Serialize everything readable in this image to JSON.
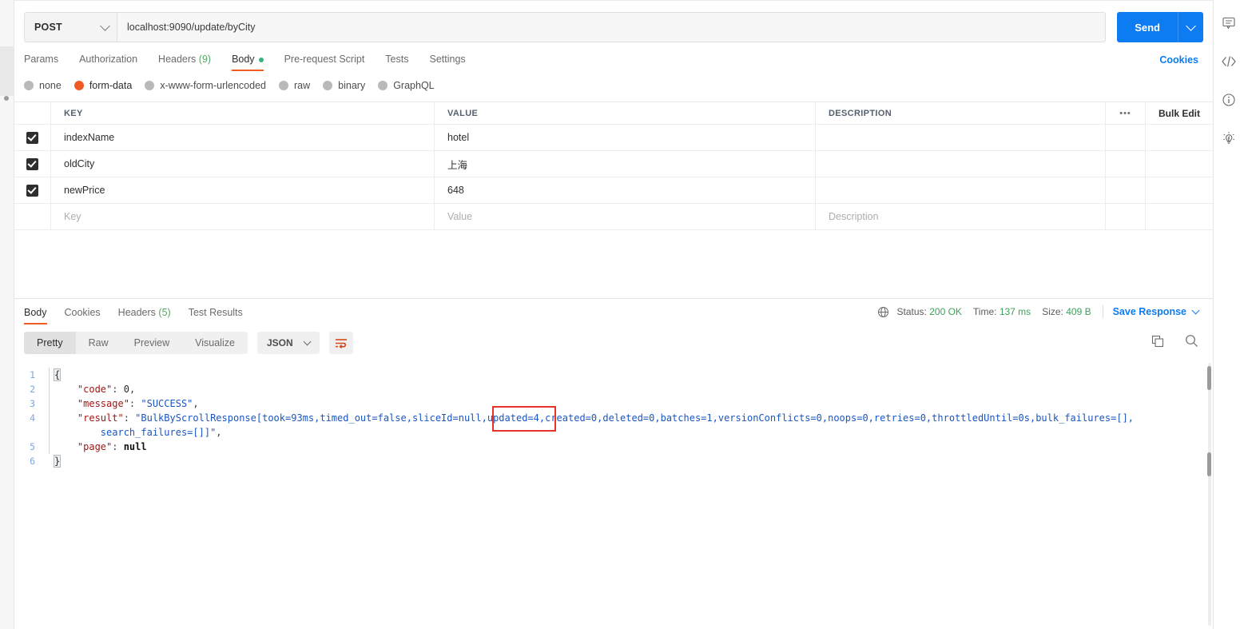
{
  "request": {
    "method": "POST",
    "url": "localhost:9090/update/byCity",
    "send_label": "Send",
    "tabs": [
      {
        "label": "Params",
        "active": false
      },
      {
        "label": "Authorization",
        "active": false
      },
      {
        "label": "Headers",
        "count": "(9)",
        "active": false
      },
      {
        "label": "Body",
        "active": true,
        "dot": true
      },
      {
        "label": "Pre-request Script",
        "active": false
      },
      {
        "label": "Tests",
        "active": false
      },
      {
        "label": "Settings",
        "active": false
      }
    ],
    "cookies_label": "Cookies",
    "body_types": [
      {
        "label": "none",
        "selected": false
      },
      {
        "label": "form-data",
        "selected": true
      },
      {
        "label": "x-www-form-urlencoded",
        "selected": false
      },
      {
        "label": "raw",
        "selected": false
      },
      {
        "label": "binary",
        "selected": false
      },
      {
        "label": "GraphQL",
        "selected": false
      }
    ]
  },
  "params_table": {
    "headers": {
      "key": "KEY",
      "value": "VALUE",
      "description": "DESCRIPTION"
    },
    "bulk_edit_label": "Bulk Edit",
    "more_label": "•••",
    "rows": [
      {
        "checked": true,
        "key": "indexName",
        "value": "hotel",
        "description": ""
      },
      {
        "checked": true,
        "key": "oldCity",
        "value": "上海",
        "description": ""
      },
      {
        "checked": true,
        "key": "newPrice",
        "value": "648",
        "description": ""
      }
    ],
    "placeholder_row": {
      "key": "Key",
      "value": "Value",
      "description": "Description"
    }
  },
  "response": {
    "tabs": [
      {
        "label": "Body",
        "active": true
      },
      {
        "label": "Cookies",
        "active": false
      },
      {
        "label": "Headers",
        "count": "(5)",
        "active": false
      },
      {
        "label": "Test Results",
        "active": false
      }
    ],
    "status_prefix": "Status:",
    "status_value": "200 OK",
    "time_prefix": "Time:",
    "time_value": "137 ms",
    "size_prefix": "Size:",
    "size_value": "409 B",
    "save_response_label": "Save Response",
    "view_modes": [
      {
        "label": "Pretty",
        "active": true
      },
      {
        "label": "Raw",
        "active": false
      },
      {
        "label": "Preview",
        "active": false
      },
      {
        "label": "Visualize",
        "active": false
      }
    ],
    "format_label": "JSON",
    "line_numbers": [
      "1",
      "2",
      "3",
      "4",
      "",
      "5",
      "6"
    ],
    "body_lines": [
      {
        "n": "1",
        "tokens": [
          {
            "t": "{",
            "c": "brk"
          }
        ]
      },
      {
        "n": "2",
        "tokens": [
          {
            "t": "    \"code\"",
            "c": "k"
          },
          {
            "t": ": ",
            "c": "p"
          },
          {
            "t": "0",
            "c": "n"
          },
          {
            "t": ",",
            "c": "p"
          }
        ]
      },
      {
        "n": "3",
        "tokens": [
          {
            "t": "    \"message\"",
            "c": "k"
          },
          {
            "t": ": ",
            "c": "p"
          },
          {
            "t": "\"SUCCESS\"",
            "c": "s"
          },
          {
            "t": ",",
            "c": "p"
          }
        ]
      },
      {
        "n": "4",
        "tokens": [
          {
            "t": "    \"result\"",
            "c": "k"
          },
          {
            "t": ": ",
            "c": "p"
          },
          {
            "t": "\"BulkByScrollResponse[took=93ms,timed_out=false,sliceId=null,updated=4,created=0,deleted=0,batches=1,versionConflicts=0,noops=0,retries=0,throttledUntil=0s,bulk_failures=[],",
            "c": "s"
          }
        ]
      },
      {
        "n": "",
        "tokens": [
          {
            "t": "        search_failures=[]]\"",
            "c": "s"
          },
          {
            "t": ",",
            "c": "p"
          }
        ]
      },
      {
        "n": "5",
        "tokens": [
          {
            "t": "    \"page\"",
            "c": "k"
          },
          {
            "t": ": ",
            "c": "p"
          },
          {
            "t": "null",
            "c": "nl"
          }
        ]
      },
      {
        "n": "6",
        "tokens": [
          {
            "t": "}",
            "c": "brk"
          }
        ]
      }
    ],
    "annotation_text": ",updated=4"
  },
  "right_rail": {
    "icons": [
      "comment-icon",
      "code-icon",
      "info-icon",
      "lightbulb-icon"
    ]
  }
}
